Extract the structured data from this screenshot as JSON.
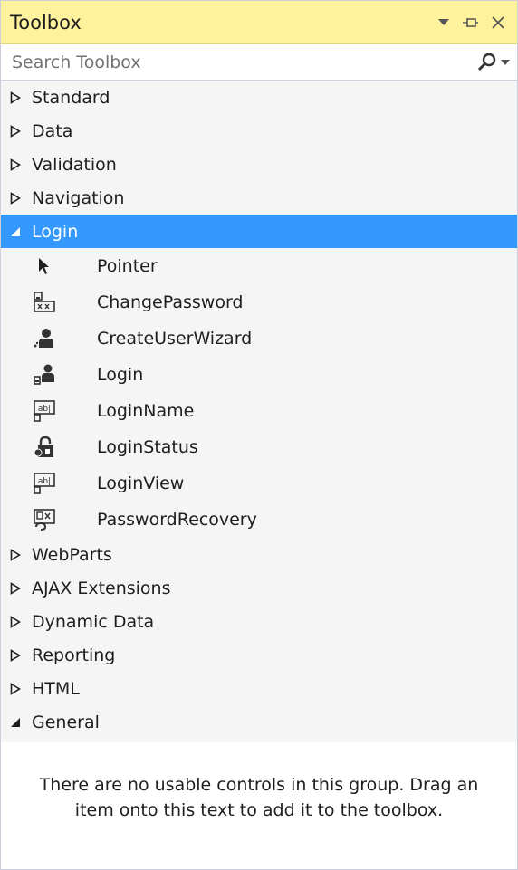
{
  "titlebar": {
    "title": "Toolbox",
    "buttons": [
      "dropdown-arrow",
      "pin",
      "close"
    ]
  },
  "search": {
    "placeholder": "Search Toolbox"
  },
  "categories": [
    {
      "label": "Standard",
      "expanded": false
    },
    {
      "label": "Data",
      "expanded": false
    },
    {
      "label": "Validation",
      "expanded": false
    },
    {
      "label": "Navigation",
      "expanded": false
    },
    {
      "label": "Login",
      "expanded": true,
      "selected": true
    },
    {
      "label": "WebParts",
      "expanded": false
    },
    {
      "label": "AJAX Extensions",
      "expanded": false
    },
    {
      "label": "Dynamic Data",
      "expanded": false
    },
    {
      "label": "Reporting",
      "expanded": false
    },
    {
      "label": "HTML",
      "expanded": false
    },
    {
      "label": "General",
      "expanded": true
    }
  ],
  "login_items": [
    {
      "label": "Pointer",
      "icon": "pointer-icon"
    },
    {
      "label": "ChangePassword",
      "icon": "change-password-icon"
    },
    {
      "label": "CreateUserWizard",
      "icon": "create-user-wizard-icon"
    },
    {
      "label": "Login",
      "icon": "login-icon"
    },
    {
      "label": "LoginName",
      "icon": "login-name-icon"
    },
    {
      "label": "LoginStatus",
      "icon": "login-status-icon"
    },
    {
      "label": "LoginView",
      "icon": "login-view-icon"
    },
    {
      "label": "PasswordRecovery",
      "icon": "password-recovery-icon"
    }
  ],
  "general": {
    "empty_message": "There are no usable controls in this group. Drag an item onto this text to add it to the toolbox."
  },
  "colors": {
    "titlebar_bg": "#fff29d",
    "selected_bg": "#3399ff",
    "panel_bg": "#f5f5f5"
  }
}
